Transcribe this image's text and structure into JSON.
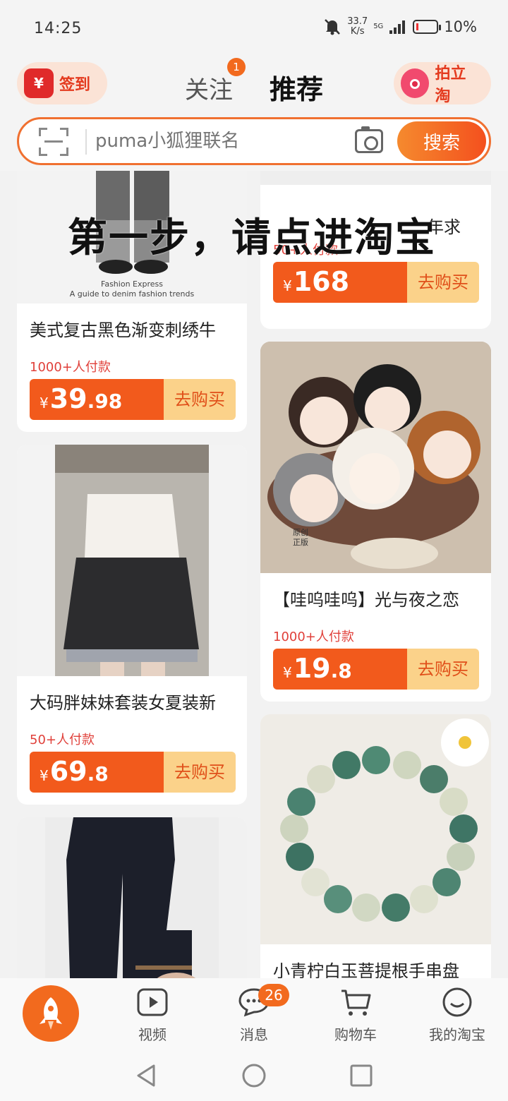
{
  "status_bar": {
    "time": "14:25",
    "net_speed_top": "33.7",
    "net_speed_unit": "K/s",
    "signal_label": "5G",
    "battery_percent": "10%"
  },
  "header": {
    "checkin_label": "签到",
    "checkin_icon": "¥",
    "follow_tab": "关注",
    "follow_badge": "1",
    "recommend_tab": "推荐",
    "snap_label": "拍立淘"
  },
  "search": {
    "placeholder": "puma小狐狸联名",
    "button_label": "搜索"
  },
  "overlay_text": "第一步，请点进淘宝",
  "products": [
    {
      "title": "美式复古黑色渐变刺绣牛",
      "sold": "1000+人付款",
      "price_int": "39",
      "price_dec": ".98",
      "buy_label": "去购买",
      "image_caption_1": "Fashion Express",
      "image_caption_2": "A guide to denim fashion trends"
    },
    {
      "title": "年求",
      "sold": "50+人付款",
      "price_int": "168",
      "price_dec": "",
      "buy_label": "去购买"
    },
    {
      "title": "大码胖妹妹套装女夏装新",
      "sold": "50+人付款",
      "price_int": "69",
      "price_dec": ".8",
      "buy_label": "去购买"
    },
    {
      "title": "【哇呜哇呜】光与夜之恋",
      "sold": "1000+人付款",
      "price_int": "19",
      "price_dec": ".8",
      "buy_label": "去购买",
      "image_badge": "原创正版"
    },
    {
      "title": "小青柠白玉菩提根手串盘",
      "sold": "",
      "price_int": "",
      "price_dec": "",
      "buy_label": ""
    }
  ],
  "currency": "¥",
  "bottom_nav": {
    "video": "视频",
    "messages": "消息",
    "messages_badge": "26",
    "cart": "购物车",
    "my_taobao": "我的淘宝"
  },
  "colors": {
    "accent": "#f25a1c",
    "buy_bg": "#fbd28a",
    "sold_text": "#e0403a"
  }
}
